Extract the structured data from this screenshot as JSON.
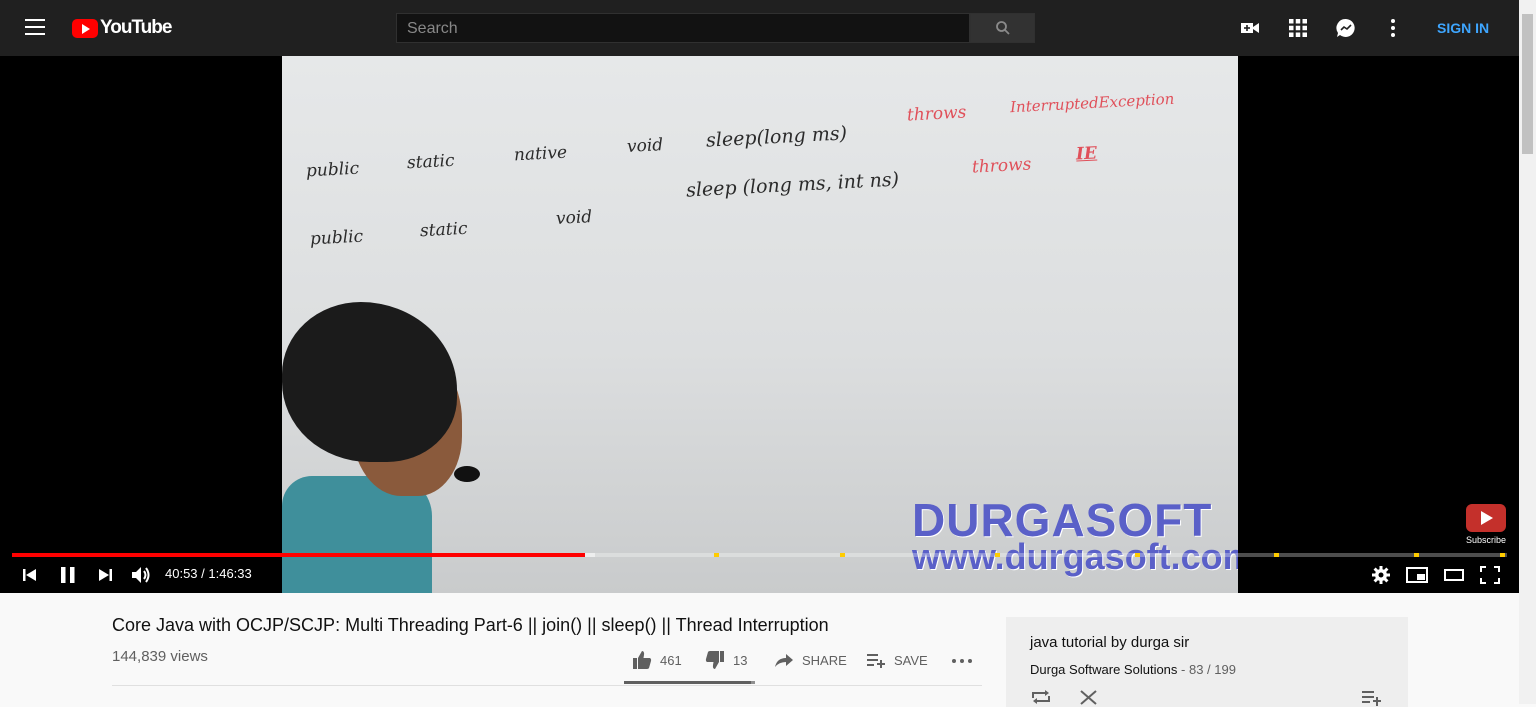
{
  "header": {
    "logo_text": "YouTube",
    "search_placeholder": "Search",
    "sign_in": "SIGN IN",
    "icons": [
      "menu-icon",
      "youtube-logo",
      "search-icon",
      "create-video-icon",
      "apps-icon",
      "messages-icon",
      "more-vert-icon"
    ]
  },
  "video": {
    "board_lines": [
      {
        "text": "public",
        "tone": "dark"
      },
      {
        "text": "static",
        "tone": "dark"
      },
      {
        "text": "native",
        "tone": "dark"
      },
      {
        "text": "void",
        "tone": "dark"
      },
      {
        "text": "sleep(long ms)",
        "tone": "dark"
      },
      {
        "text": "throws",
        "tone": "red"
      },
      {
        "text": "InterruptedException",
        "tone": "red"
      },
      {
        "text": "public",
        "tone": "dark"
      },
      {
        "text": "static",
        "tone": "dark"
      },
      {
        "text": "void",
        "tone": "dark"
      },
      {
        "text": "sleep (long ms, int ns)",
        "tone": "dark"
      },
      {
        "text": "throws",
        "tone": "red"
      },
      {
        "text": "IE",
        "tone": "red"
      }
    ],
    "watermark_line1": "DURGASOFT",
    "watermark_line2": "www.durgasoft.com",
    "subscribe_label": "Subscribe",
    "progress_fraction": 0.383,
    "buffered_fraction": 0.39,
    "current_time": "40:53",
    "duration": "1:46:33",
    "time_display": "40:53 / 1:46:33",
    "colors": {
      "played": "#ff0000",
      "marker": "#ffcc00"
    }
  },
  "info": {
    "title": "Core Java with OCJP/SCJP: Multi Threading Part-6 || join() || sleep() || Thread Interruption",
    "views": "144,839 views",
    "likes": "461",
    "dislikes": "13",
    "share_label": "SHARE",
    "save_label": "SAVE",
    "like_fraction": 0.97
  },
  "playlist": {
    "title": "java tutorial by durga sir",
    "channel": "Durga Software Solutions",
    "position": "- 83 / 199"
  }
}
